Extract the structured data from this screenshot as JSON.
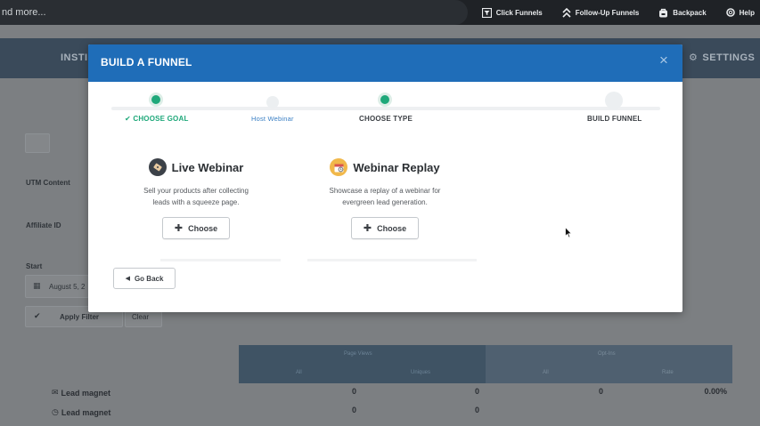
{
  "topbar": {
    "search_text": "nd more...",
    "links": [
      {
        "label": "Click Funnels",
        "icon": "funnel-icon"
      },
      {
        "label": "Follow-Up Funnels",
        "icon": "chevrons-up-icon"
      },
      {
        "label": "Backpack",
        "icon": "backpack-icon"
      },
      {
        "label": "Help",
        "icon": "lifebuoy-icon"
      }
    ]
  },
  "nav": {
    "left_text": "INSTI",
    "right_text": "SETTINGS"
  },
  "side": {
    "utm_label": "UTM Content",
    "affiliate_label": "Affiliate ID",
    "start_label": "Start",
    "date_value": "August 5, 2",
    "apply_label": "Apply Filter",
    "clear_label": "Clear"
  },
  "stats": {
    "head_left": "Page Views",
    "head_right": "Opt-Ins",
    "sub_all": "All",
    "sub_uniques": "Uniques",
    "sub_all2": "All",
    "sub_rate": "Rate",
    "rows": [
      {
        "label": "Lead magnet",
        "icon": "envelope-icon",
        "c1": "0",
        "c2": "0",
        "c3": "0",
        "c4": "0.00%"
      },
      {
        "label": "Lead magnet",
        "icon": "clock-icon",
        "c1": "0",
        "c2": "0"
      }
    ]
  },
  "modal": {
    "title": "BUILD A FUNNEL",
    "close": "×",
    "steps": [
      {
        "label": "CHOOSE GOAL",
        "check": "✔"
      },
      {
        "label": "Host Webinar"
      },
      {
        "label": "CHOOSE TYPE"
      },
      {
        "label": "BUILD FUNNEL"
      }
    ],
    "options": [
      {
        "title": "Live Webinar",
        "desc_line1": "Sell your products after collecting",
        "desc_line2": "leads with a squeeze page.",
        "button": "Choose"
      },
      {
        "title": "Webinar Replay",
        "desc_line1": "Showcase a replay of a webinar for",
        "desc_line2": "evergreen lead generation.",
        "button": "Choose"
      }
    ],
    "back_button": "Go Back"
  },
  "colors": {
    "header_blue": "#1f6db8",
    "step_green": "#1fa87a",
    "link_blue": "#3a7fc4"
  }
}
